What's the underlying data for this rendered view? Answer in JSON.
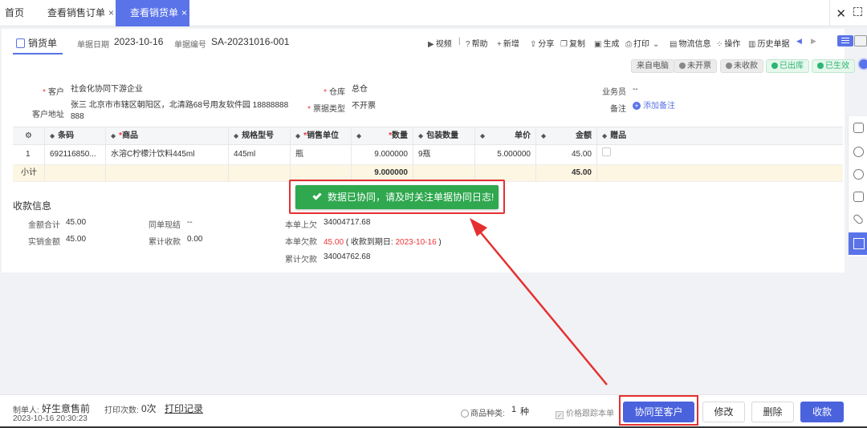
{
  "tabs": {
    "home": "首页",
    "sales_order": "查看销售订单",
    "delivery_note": "查看销货单",
    "close_glyph": "×"
  },
  "window": {
    "close": "✕"
  },
  "header": {
    "doc_title": "销货单",
    "date_label": "单据日期",
    "date_value": "2023-10-16",
    "no_label": "单据编号",
    "no_value": "SA-20231016-001"
  },
  "toolbar": {
    "video": "视频",
    "sep": "|",
    "help": "帮助",
    "add": "新增",
    "share": "分享",
    "copy": "复制",
    "generate": "生成",
    "print": "打印",
    "logistics": "物流信息",
    "operate": "操作",
    "history": "历史单据"
  },
  "badges": {
    "from_pc": "来自电脑",
    "not_invoiced": "未开票",
    "not_collected": "未收款",
    "shipped": "已出库",
    "effective": "已生效"
  },
  "form": {
    "customer_label": "客户",
    "customer_value": "社会化协同下游企业",
    "warehouse_label": "仓库",
    "warehouse_value": "总仓",
    "salesman_label": "业务员",
    "salesman_value": "--",
    "address_label": "客户地址",
    "address_value_line1": "张三 北京市市辖区朝阳区，北清路68号用友软件园 18888888",
    "address_value_line2": "888",
    "invoice_type_label": "票据类型",
    "invoice_type_value": "不开票",
    "remark_label": "备注",
    "remark_add": "添加备注"
  },
  "table": {
    "columns": {
      "barcode": "条码",
      "product": "商品",
      "spec": "规格型号",
      "unit": "销售单位",
      "qty": "数量",
      "pack_qty": "包装数量",
      "price": "单价",
      "amount": "金额",
      "gift": "赠品"
    },
    "rows": [
      {
        "no": "1",
        "barcode": "692116850...",
        "product": "水溶C柠檬汁饮料445ml",
        "spec": "445ml",
        "unit": "瓶",
        "qty": "9.000000",
        "pack_qty": "9瓶",
        "price": "5.000000",
        "amount": "45.00"
      }
    ],
    "subtotal": {
      "label": "小计",
      "qty": "9.000000",
      "amount": "45.00"
    }
  },
  "toast": {
    "message": "数据已协同，请及时关注单据协同日志!"
  },
  "payment": {
    "title": "收款信息",
    "total_label": "金额合计",
    "total_value": "45.00",
    "actual_label": "实销金额",
    "actual_value": "45.00",
    "cash_label": "同单现结",
    "cash_value": "--",
    "cum_collect_label": "累计收款",
    "cum_collect_value": "0.00",
    "prev_debt_label": "本单上欠",
    "prev_debt_value": "34004717.68",
    "this_debt_label": "本单欠款",
    "this_debt_value": "45.00",
    "this_debt_due_prefix": "( 收款到期日: ",
    "this_debt_due_date": "2023-10-16",
    "this_debt_due_suffix": " )",
    "cum_debt_label": "累计欠款",
    "cum_debt_value": "34004762.68"
  },
  "footer": {
    "creator_label": "制单人:",
    "creator_value": "好生意售前",
    "created_time": "2023-10-16 20:30:23",
    "print_count_label": "打印次数:",
    "print_count_value": "0次",
    "print_record": "打印记录",
    "kinds_label": "商品种类:",
    "kinds_value": "1",
    "kinds_unit": "种",
    "price_track": "价格跟踪本单",
    "btn_sync": "协同至客户",
    "btn_edit": "修改",
    "btn_delete": "删除",
    "btn_collect": "收款"
  },
  "colors": {
    "accent": "#5a73e8",
    "primary_button": "#4a62dc",
    "toast_green": "#2fa84f",
    "highlight_red": "#e53030",
    "subtotal_bg": "#fdf6e3"
  }
}
